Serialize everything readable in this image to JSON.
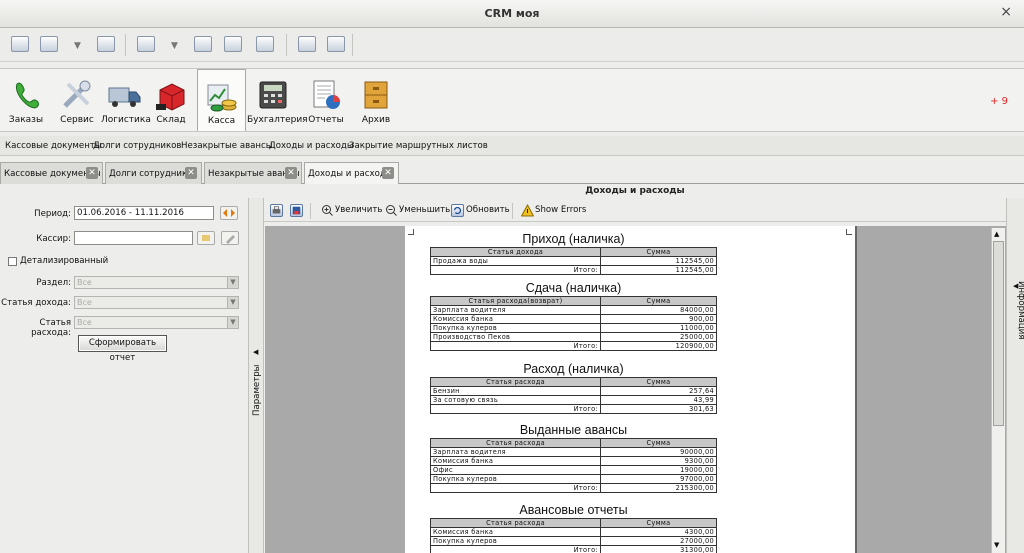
{
  "window": {
    "title": "CRM моя",
    "close_glyph": "×"
  },
  "modules": [
    {
      "name": "zakazy",
      "label": "Заказы",
      "icon": "phone-icon"
    },
    {
      "name": "servis",
      "label": "Сервис",
      "icon": "tools-icon"
    },
    {
      "name": "logistika",
      "label": "Логистика",
      "icon": "truck-icon"
    },
    {
      "name": "sklad",
      "label": "Склад",
      "icon": "warehouse-icon"
    },
    {
      "name": "kassa",
      "label": "Касса",
      "icon": "cash-icon"
    },
    {
      "name": "buhgalteriya",
      "label": "Бухгалтерия",
      "icon": "calculator-icon"
    },
    {
      "name": "otchety",
      "label": "Отчеты",
      "icon": "report-icon"
    },
    {
      "name": "arhiv",
      "label": "Архив",
      "icon": "archive-icon"
    }
  ],
  "badge": "+ 9",
  "submenu": [
    "Кассовые документы",
    "Долги сотрудников",
    "Незакрытые авансы",
    "Доходы и расходы",
    "Закрытие маршрутных листов"
  ],
  "tabs": [
    "Кассовые документы",
    "Долги сотрудников",
    "Незакрытые авансы",
    "Доходы и расходы"
  ],
  "right_title": "Доходы и расходы",
  "params": {
    "period_label": "Период:",
    "period_value": "01.06.2016 - 11.11.2016",
    "cashier_label": "Кассир:",
    "cashier_value": "",
    "detailed_label": "Детализированный",
    "section_label": "Раздел:",
    "section_value": "Все",
    "income_label": "Статья дохода:",
    "income_value": "Все",
    "expense_label": "Статья расхода:",
    "expense_value": "Все",
    "build_button": "Сформировать отчет",
    "panel_label": "Параметры"
  },
  "info_label": "Информация",
  "report_toolbar": {
    "zoom_in": "Увеличить",
    "zoom_out": "Уменьшить",
    "refresh": "Обновить",
    "show_errors": "Show Errors"
  },
  "report": {
    "sections": [
      {
        "title": "Приход (наличка)",
        "col1": "Статья дохода",
        "col2": "Сумма",
        "rows": [
          [
            "Продажа воды",
            "112545,00"
          ]
        ],
        "total_label": "Итого:",
        "total": "112545,00"
      },
      {
        "title": "Сдача (наличка)",
        "col1": "Статья расхода(возврат)",
        "col2": "Сумма",
        "rows": [
          [
            "Зарплата водителя",
            "84000,00"
          ],
          [
            "Комиссия банка",
            "900,00"
          ],
          [
            "Покупка кулеров",
            "11000,00"
          ],
          [
            "Производство Пеков",
            "25000,00"
          ]
        ],
        "total_label": "Итого:",
        "total": "120900,00"
      },
      {
        "title": "Расход (наличка)",
        "col1": "Статья расхода",
        "col2": "Сумма",
        "rows": [
          [
            "Бензин",
            "257,64"
          ],
          [
            "За сотовую связь",
            "43,99"
          ]
        ],
        "total_label": "Итого:",
        "total": "301,63"
      },
      {
        "title": "Выданные авансы",
        "col1": "Статья расхода",
        "col2": "Сумма",
        "rows": [
          [
            "Зарплата водителя",
            "90000,00"
          ],
          [
            "Комиссия банка",
            "9300,00"
          ],
          [
            "Офис",
            "19000,00"
          ],
          [
            "Покупка кулеров",
            "97000,00"
          ]
        ],
        "total_label": "Итого:",
        "total": "215300,00"
      },
      {
        "title": "Авансовые отчеты",
        "col1": "Статья расхода",
        "col2": "Сумма",
        "rows": [
          [
            "Комиссия банка",
            "4300,00"
          ],
          [
            "Покупка кулеров",
            "27000,00"
          ]
        ],
        "total_label": "Итого:",
        "total": "31300,00"
      }
    ]
  },
  "colors": {
    "accent": "#d22222",
    "background": "#ededeb"
  }
}
